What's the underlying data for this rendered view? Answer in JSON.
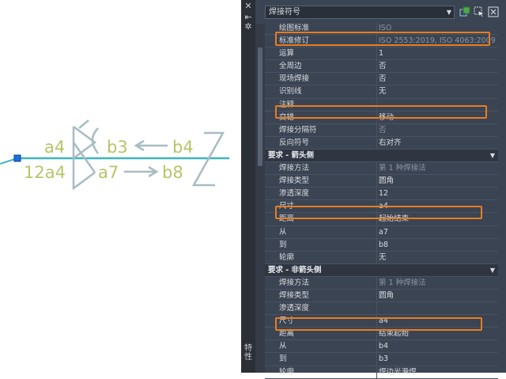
{
  "drawing": {
    "arrow_side_labels": {
      "left": "a4",
      "middle": "b3",
      "right": "b4"
    },
    "other_side_labels": {
      "left": "12a4",
      "middle": "a7",
      "right": "b8"
    },
    "colors": {
      "text": "#b7c468",
      "reference_line": "#3fb6bd",
      "symbol": "#a8bcc2",
      "grip": "#1e6fe0"
    }
  },
  "side_strip": {
    "close_icon": "close-icon",
    "pin_icon": "pin-icon",
    "settings_icon": "settings-icon",
    "label": "特性"
  },
  "header": {
    "selected_type": "焊接符号",
    "buttons": [
      "quick-select-icon",
      "select-objects-icon",
      "toggle-pickadd-icon"
    ]
  },
  "properties": {
    "general": [
      {
        "name": "绘图标准",
        "value": "ISO",
        "dim": true
      },
      {
        "name": "标准修订",
        "value": "ISO 2553:2019, ISO 4063:2009",
        "dim": true
      },
      {
        "name": "运算",
        "value": "1",
        "dim": false
      },
      {
        "name": "全周边",
        "value": "否",
        "dim": false
      },
      {
        "name": "现场焊接",
        "value": "否",
        "dim": false
      },
      {
        "name": "识别线",
        "value": "无",
        "dim": false
      },
      {
        "name": "注释",
        "value": "",
        "dim": false
      },
      {
        "name": "交错",
        "value": "移动",
        "dim": false
      },
      {
        "name": "焊接分隔符",
        "value": "否",
        "dim": true
      },
      {
        "name": "反向符号",
        "value": "右对齐",
        "dim": false
      }
    ],
    "arrow_side": {
      "title": "要求 - 箭头侧",
      "rows": [
        {
          "name": "焊接方法",
          "value": "第 1 种焊接法",
          "dim": true
        },
        {
          "name": "焊接类型",
          "value": "圆角",
          "dim": false
        },
        {
          "name": "渗透深度",
          "value": "12",
          "dim": false
        },
        {
          "name": "尺寸",
          "value": "a4",
          "dim": false
        },
        {
          "name": "距离",
          "value": "起始结束",
          "dim": false
        },
        {
          "name": "从",
          "value": "a7",
          "dim": false
        },
        {
          "name": "到",
          "value": "b8",
          "dim": false
        },
        {
          "name": "轮廓",
          "value": "无",
          "dim": false
        }
      ]
    },
    "other_side": {
      "title": "要求 - 非箭头侧",
      "rows": [
        {
          "name": "焊接方法",
          "value": "第 1 种焊接法",
          "dim": true
        },
        {
          "name": "焊接类型",
          "value": "圆角",
          "dim": false
        },
        {
          "name": "渗透深度",
          "value": "",
          "dim": false
        },
        {
          "name": "尺寸",
          "value": "a4",
          "dim": false
        },
        {
          "name": "距离",
          "value": "结束起始",
          "dim": false
        },
        {
          "name": "从",
          "value": "b4",
          "dim": false
        },
        {
          "name": "到",
          "value": "b3",
          "dim": false
        },
        {
          "name": "轮廓",
          "value": "焊边光滑焊",
          "dim": false
        }
      ]
    }
  },
  "highlight_color": "#e87d1e"
}
